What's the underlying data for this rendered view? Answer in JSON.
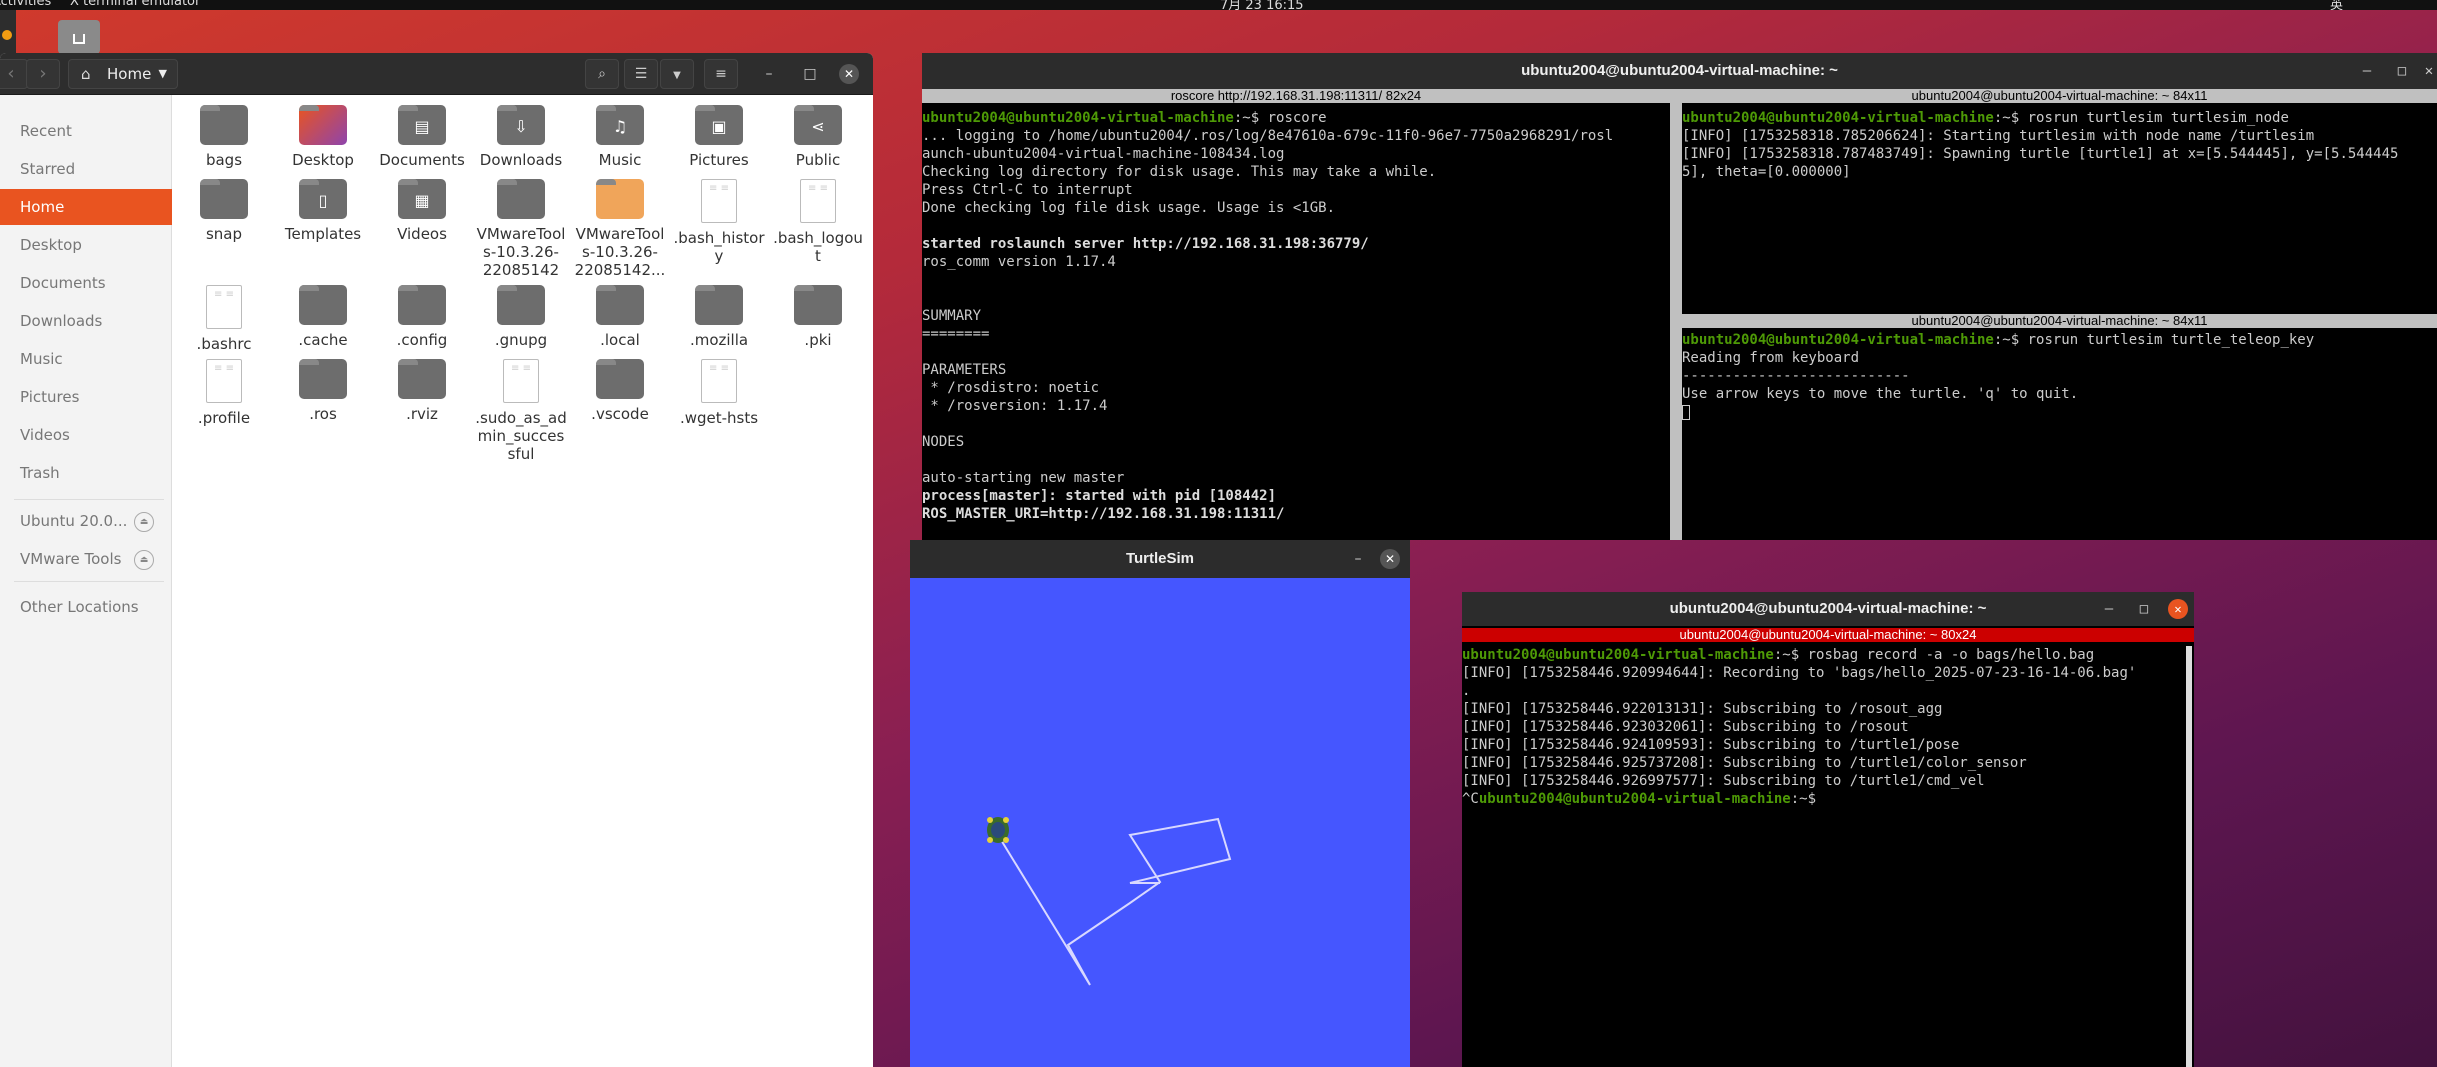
{
  "topbar": {
    "left_text": "Activities",
    "app_menu": "X terminal emulator",
    "clock": "7月 23 16:15",
    "tray": "英"
  },
  "colors": {
    "accent": "#e95420",
    "prompt": "#4e9a06",
    "turtle_bg": "#4556ff"
  },
  "files": {
    "path": "Home",
    "sidebar": [
      {
        "label": "Recent",
        "icon": "clock-icon"
      },
      {
        "label": "Starred",
        "icon": "star-icon"
      },
      {
        "label": "Home",
        "icon": "home-icon",
        "active": true
      },
      {
        "label": "Desktop",
        "icon": "desktop-icon"
      },
      {
        "label": "Documents",
        "icon": "documents-icon"
      },
      {
        "label": "Downloads",
        "icon": "downloads-icon"
      },
      {
        "label": "Music",
        "icon": "music-icon"
      },
      {
        "label": "Pictures",
        "icon": "pictures-icon"
      },
      {
        "label": "Videos",
        "icon": "videos-icon"
      },
      {
        "label": "Trash",
        "icon": "trash-icon"
      },
      {
        "label": "Ubuntu 20.0...",
        "icon": "disc-icon",
        "eject": true
      },
      {
        "label": "VMware Tools",
        "icon": "disc-icon",
        "eject": true
      },
      {
        "label": "Other Locations",
        "icon": "plus-icon"
      }
    ],
    "items": [
      {
        "label": "bags",
        "kind": "folder"
      },
      {
        "label": "Desktop",
        "kind": "desktop"
      },
      {
        "label": "Documents",
        "kind": "folder",
        "glyph": "▤"
      },
      {
        "label": "Downloads",
        "kind": "folder",
        "glyph": "⇩"
      },
      {
        "label": "Music",
        "kind": "folder",
        "glyph": "♫"
      },
      {
        "label": "Pictures",
        "kind": "folder",
        "glyph": "▣"
      },
      {
        "label": "Public",
        "kind": "folder",
        "glyph": "⋖"
      },
      {
        "label": "snap",
        "kind": "folder"
      },
      {
        "label": "Templates",
        "kind": "folder",
        "glyph": "▯"
      },
      {
        "label": "Videos",
        "kind": "folder",
        "glyph": "▦"
      },
      {
        "label": "VMwareTools-10.3.26-22085142",
        "kind": "folder"
      },
      {
        "label": "VMwareTools-10.3.26-22085142...",
        "kind": "vm"
      },
      {
        "label": ".bash_history",
        "kind": "doc"
      },
      {
        "label": ".bash_logout",
        "kind": "doc"
      },
      {
        "label": ".bashrc",
        "kind": "doc"
      },
      {
        "label": ".cache",
        "kind": "folder"
      },
      {
        "label": ".config",
        "kind": "folder"
      },
      {
        "label": ".gnupg",
        "kind": "folder"
      },
      {
        "label": ".local",
        "kind": "folder"
      },
      {
        "label": ".mozilla",
        "kind": "folder"
      },
      {
        "label": ".pki",
        "kind": "folder"
      },
      {
        "label": ".profile",
        "kind": "doc"
      },
      {
        "label": ".ros",
        "kind": "folder"
      },
      {
        "label": ".rviz",
        "kind": "folder"
      },
      {
        "label": ".sudo_as_admin_successful",
        "kind": "doc"
      },
      {
        "label": ".vscode",
        "kind": "folder"
      },
      {
        "label": ".wget-hsts",
        "kind": "doc"
      }
    ]
  },
  "main_terminal": {
    "title": "ubuntu2004@ubuntu2004-virtual-machine: ~",
    "panes": [
      {
        "title": "roscore http://192.168.31.198:11311/ 82x24",
        "lines": [
          [
            {
              "t": "ubuntu2004@ubuntu2004-virtual-machine",
              "c": "pr"
            },
            {
              "t": ":~$ roscore"
            }
          ],
          [
            {
              "t": "... logging to /home/ubuntu2004/.ros/log/8e47610a-679c-11f0-96e7-7750a2968291/rosl"
            }
          ],
          [
            {
              "t": "aunch-ubuntu2004-virtual-machine-108434.log"
            }
          ],
          [
            {
              "t": "Checking log directory for disk usage. This may take a while."
            }
          ],
          [
            {
              "t": "Press Ctrl-C to interrupt"
            }
          ],
          [
            {
              "t": "Done checking log file disk usage. Usage is <1GB."
            }
          ],
          [
            {
              "t": ""
            }
          ],
          [
            {
              "t": "started roslaunch server http://192.168.31.198:36779/",
              "c": "bold"
            }
          ],
          [
            {
              "t": "ros_comm version 1.17.4"
            }
          ],
          [
            {
              "t": ""
            }
          ],
          [
            {
              "t": ""
            }
          ],
          [
            {
              "t": "SUMMARY"
            }
          ],
          [
            {
              "t": "========"
            }
          ],
          [
            {
              "t": ""
            }
          ],
          [
            {
              "t": "PARAMETERS"
            }
          ],
          [
            {
              "t": " * /rosdistro: noetic"
            }
          ],
          [
            {
              "t": " * /rosversion: 1.17.4"
            }
          ],
          [
            {
              "t": ""
            }
          ],
          [
            {
              "t": "NODES"
            }
          ],
          [
            {
              "t": ""
            }
          ],
          [
            {
              "t": "auto-starting new master"
            }
          ],
          [
            {
              "t": "process[master]: started with pid [108442]",
              "c": "bold"
            }
          ],
          [
            {
              "t": "ROS_MASTER_URI=http://192.168.31.198:11311/",
              "c": "bold"
            }
          ]
        ]
      },
      {
        "title": "ubuntu2004@ubuntu2004-virtual-machine: ~ 84x11",
        "lines": [
          [
            {
              "t": "ubuntu2004@ubuntu2004-virtual-machine",
              "c": "pr"
            },
            {
              "t": ":~$ rosrun turtlesim turtlesim_node"
            }
          ],
          [
            {
              "t": "[INFO] [1753258318.785206624]: Starting turtlesim with node name /turtlesim"
            }
          ],
          [
            {
              "t": "[INFO] [1753258318.787483749]: Spawning turtle [turtle1] at x=[5.544445], y=[5.544445"
            }
          ],
          [
            {
              "t": "5], theta=[0.000000]"
            }
          ]
        ]
      },
      {
        "title": "ubuntu2004@ubuntu2004-virtual-machine: ~ 84x11",
        "lines": [
          [
            {
              "t": "ubuntu2004@ubuntu2004-virtual-machine",
              "c": "pr"
            },
            {
              "t": ":~$ rosrun turtlesim turtle_teleop_key"
            }
          ],
          [
            {
              "t": "Reading from keyboard"
            }
          ],
          [
            {
              "t": "---------------------------"
            }
          ],
          [
            {
              "t": "Use arrow keys to move the turtle. 'q' to quit."
            }
          ]
        ]
      }
    ]
  },
  "turtlesim": {
    "title": "TurtleSim"
  },
  "record_terminal": {
    "title": "ubuntu2004@ubuntu2004-virtual-machine: ~",
    "pane_title": "ubuntu2004@ubuntu2004-virtual-machine: ~ 80x24",
    "lines": [
      [
        {
          "t": "ubuntu2004@ubuntu2004-virtual-machine",
          "c": "pr"
        },
        {
          "t": ":~$ rosbag record -a -o bags/hello.bag"
        }
      ],
      [
        {
          "t": "[INFO] [1753258446.920994644]: Recording to 'bags/hello_2025-07-23-16-14-06.bag'"
        }
      ],
      [
        {
          "t": "."
        }
      ],
      [
        {
          "t": "[INFO] [1753258446.922013131]: Subscribing to /rosout_agg"
        }
      ],
      [
        {
          "t": "[INFO] [1753258446.923032061]: Subscribing to /rosout"
        }
      ],
      [
        {
          "t": "[INFO] [1753258446.924109593]: Subscribing to /turtle1/pose"
        }
      ],
      [
        {
          "t": "[INFO] [1753258446.925737208]: Subscribing to /turtle1/color_sensor"
        }
      ],
      [
        {
          "t": "[INFO] [1753258446.926997577]: Subscribing to /turtle1/cmd_vel"
        }
      ],
      [
        {
          "t": "^C"
        },
        {
          "t": "ubuntu2004@ubuntu2004-virtual-machine",
          "c": "pr"
        },
        {
          "t": ":~$ "
        }
      ]
    ]
  }
}
